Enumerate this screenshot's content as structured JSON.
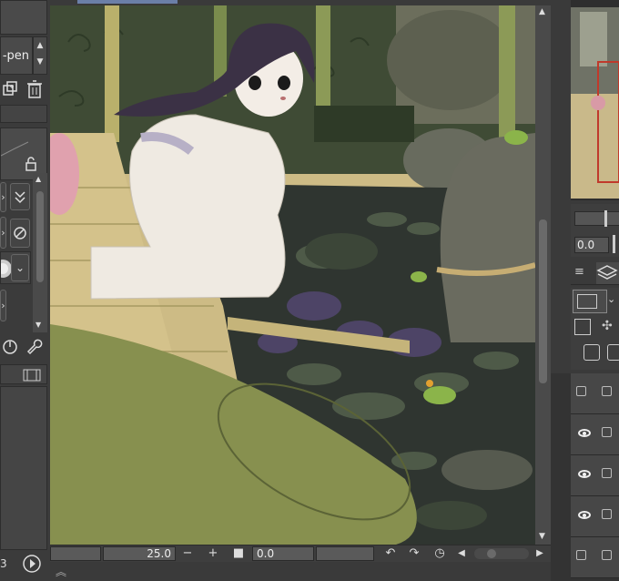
{
  "left_panel": {
    "brush_name": "-pen",
    "bottom_number": "3"
  },
  "bottom_bar": {
    "zoom_value": "25.0",
    "zoom_out": "−",
    "zoom_in": "+",
    "rotation_value": "0.0"
  },
  "right_panel": {
    "rotation_value": "0.0"
  },
  "icons": [
    "dropdown-icon",
    "duplicate-icon",
    "trash-icon",
    "lock-icon",
    "check-icon",
    "brush-tip-icon",
    "rotate-icon",
    "wrench-icon",
    "film-icon",
    "play-icon",
    "undo-icon",
    "redo-icon",
    "reset-rotation-icon",
    "layers-icon",
    "menu-icon",
    "eye-icon",
    "chevron-up-icon"
  ],
  "colors": {
    "panel_bg": "#3a3a3a",
    "canvas_bg": "#d5c28d",
    "pond": "#2f3530",
    "forest": "#3c4a33",
    "accent": "#c0392b"
  }
}
